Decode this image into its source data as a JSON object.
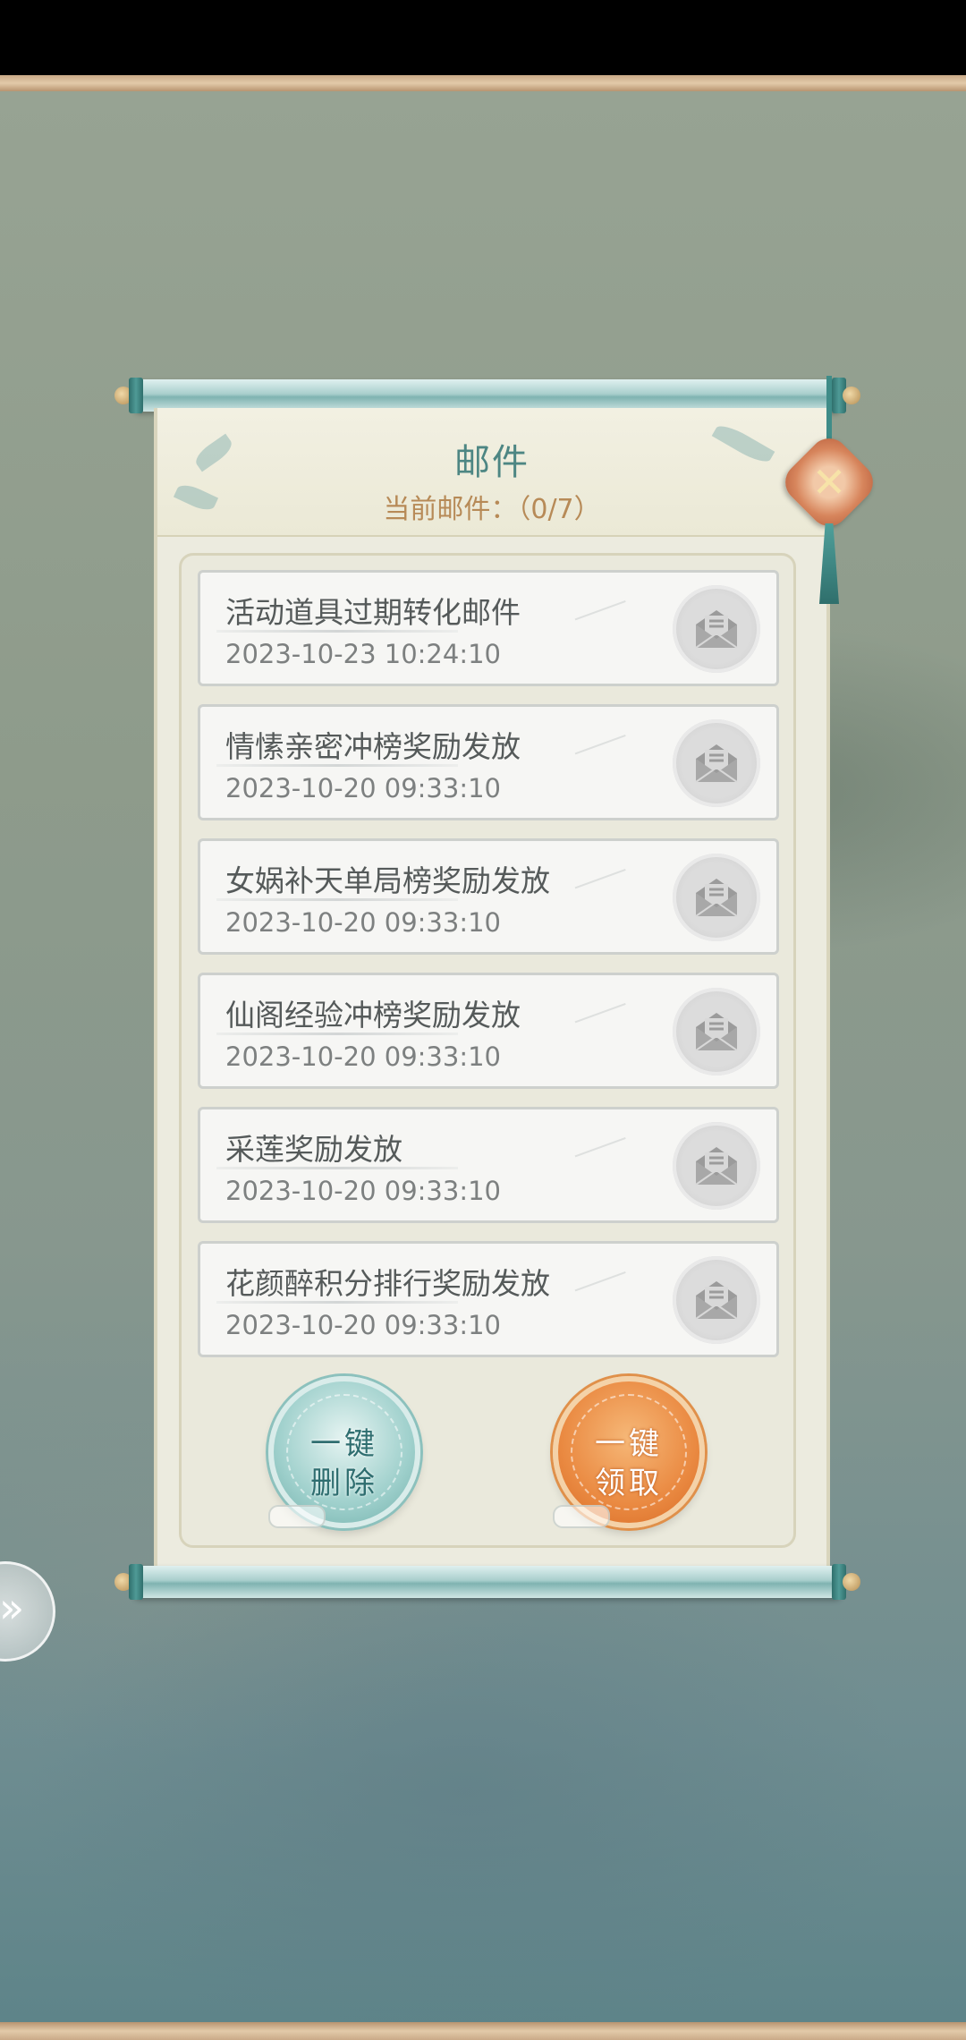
{
  "mail": {
    "title": "邮件",
    "count_label": "当前邮件：（0/7）",
    "items": [
      {
        "title": "活动道具过期转化邮件",
        "time": "2023-10-23 10:24:10"
      },
      {
        "title": "情愫亲密冲榜奖励发放",
        "time": "2023-10-20 09:33:10"
      },
      {
        "title": "女娲补天单局榜奖励发放",
        "time": "2023-10-20 09:33:10"
      },
      {
        "title": "仙阁经验冲榜奖励发放",
        "time": "2023-10-20 09:33:10"
      },
      {
        "title": "采莲奖励发放",
        "time": "2023-10-20 09:33:10"
      },
      {
        "title": "花颜醉积分排行奖励发放",
        "time": "2023-10-20 09:33:10"
      }
    ]
  },
  "buttons": {
    "delete_all": {
      "line1": "一键",
      "line2": "删除"
    },
    "claim_all": {
      "line1": "一键",
      "line2": "领取"
    }
  },
  "icons": {
    "mail": "envelope-icon",
    "close": "close-knot-icon",
    "expand": "double-chevron-right-icon"
  },
  "colors": {
    "title": "#4d8683",
    "subtitle": "#b78a57",
    "delete_button": "#9fd0cc",
    "claim_button": "#ea8a42"
  }
}
